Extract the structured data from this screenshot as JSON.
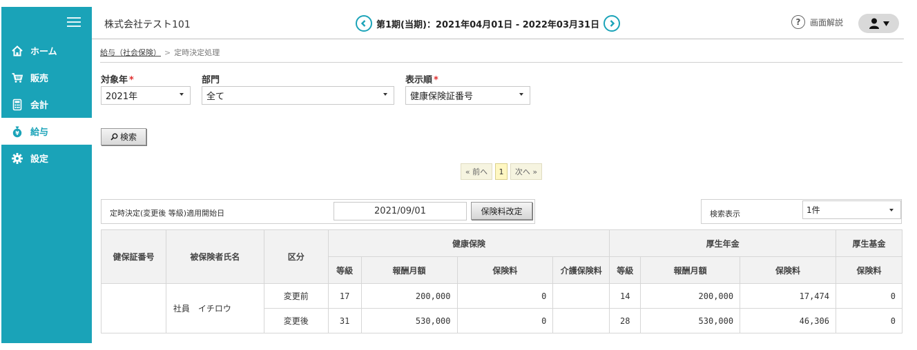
{
  "header": {
    "company": "株式会社テスト101",
    "period": "第1期(当期)：2021年04月01日 - 2022年03月31日",
    "help_label": "画面解説"
  },
  "sidebar": {
    "items": [
      {
        "label": "ホーム",
        "icon": "home-icon",
        "active": false
      },
      {
        "label": "販売",
        "icon": "cart-icon",
        "active": false
      },
      {
        "label": "会計",
        "icon": "calculator-icon",
        "active": false
      },
      {
        "label": "給与",
        "icon": "money-bag-icon",
        "active": true
      },
      {
        "label": "設定",
        "icon": "gear-icon",
        "active": false
      }
    ]
  },
  "breadcrumb": {
    "parent": "給与（社会保険）",
    "separator": ">",
    "current": "定時決定処理"
  },
  "filters": {
    "year_label": "対象年",
    "year_value": "2021年",
    "dept_label": "部門",
    "dept_value": "全て",
    "order_label": "表示順",
    "order_value": "健康保険証番号",
    "required_mark": "*"
  },
  "search_button": "検索",
  "pager": {
    "prev": "« 前へ",
    "current": "1",
    "next": "次へ »"
  },
  "apply": {
    "label": "定時決定(変更後 等級)適用開始日",
    "date": "2021/09/01",
    "button": "保険料改定"
  },
  "display": {
    "label": "検索表示",
    "value": "1件"
  },
  "table": {
    "headers": {
      "cert_no": "健保証番号",
      "name": "被保険者氏名",
      "kubun": "区分",
      "health": "健康保険",
      "pension": "厚生年金",
      "fund": "厚生基金",
      "grade": "等級",
      "monthly": "報酬月額",
      "premium": "保険料",
      "care": "介護保険料"
    },
    "employee": {
      "cert_no": "",
      "name": "社員　イチロウ",
      "rows": [
        {
          "kubun": "変更前",
          "h_grade": "17",
          "h_monthly": "200,000",
          "h_premium": "0",
          "h_care": "",
          "p_grade": "14",
          "p_monthly": "200,000",
          "p_premium": "17,474",
          "f_premium": "0"
        },
        {
          "kubun": "変更後",
          "h_grade": "31",
          "h_monthly": "530,000",
          "h_premium": "0",
          "h_care": "",
          "p_grade": "28",
          "p_monthly": "530,000",
          "p_premium": "46,306",
          "f_premium": "0"
        }
      ]
    }
  },
  "colors": {
    "accent": "#1aa3b8",
    "required": "#e03030",
    "header_bg": "#f2f2f2"
  }
}
